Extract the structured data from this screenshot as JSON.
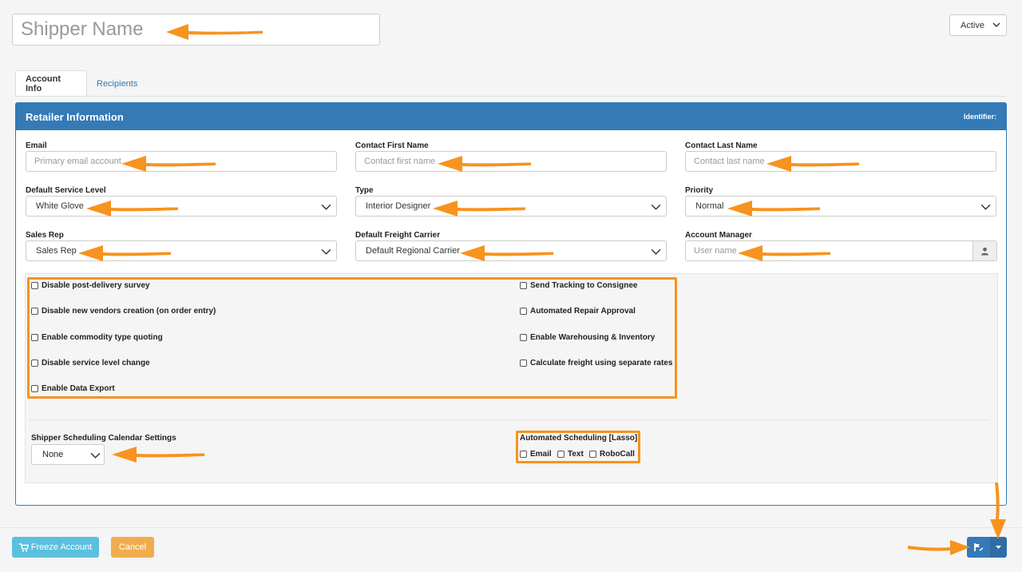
{
  "header": {
    "name_placeholder": "Shipper Name",
    "status_value": "Active"
  },
  "tabs": [
    {
      "label": "Account Info"
    },
    {
      "label": "Recipients"
    }
  ],
  "panel": {
    "title": "Retailer Information",
    "identifier_label": "Identifier:"
  },
  "fields": {
    "email": {
      "label": "Email",
      "placeholder": "Primary email account"
    },
    "contact_first": {
      "label": "Contact First Name",
      "placeholder": "Contact first name"
    },
    "contact_last": {
      "label": "Contact Last Name",
      "placeholder": "Contact last name"
    },
    "service_level": {
      "label": "Default Service Level",
      "value": "White Glove"
    },
    "type": {
      "label": "Type",
      "value": "Interior Designer"
    },
    "priority": {
      "label": "Priority",
      "value": "Normal"
    },
    "sales_rep": {
      "label": "Sales Rep",
      "value": "Sales Rep"
    },
    "freight_carrier": {
      "label": "Default Freight Carrier",
      "value": "Default Regional Carrier"
    },
    "account_manager": {
      "label": "Account Manager",
      "placeholder": "User name"
    }
  },
  "options_left": [
    "Disable post-delivery survey",
    "Disable new vendors creation (on order entry)",
    "Enable commodity type quoting",
    "Disable service level change",
    "Enable Data Export"
  ],
  "options_right": [
    "Send Tracking to Consignee",
    "Automated Repair Approval",
    "Enable Warehousing & Inventory",
    "Calculate freight using separate rates"
  ],
  "scheduling": {
    "calendar_label": "Shipper Scheduling Calendar Settings",
    "calendar_value": "None",
    "automated_label": "Automated Scheduling [Lasso]",
    "automated_options": [
      "Email",
      "Text",
      "RoboCall"
    ]
  },
  "footer": {
    "freeze_label": "Freeze Account",
    "cancel_label": "Cancel"
  },
  "colors": {
    "primary": "#337ab7",
    "info": "#5bc0de",
    "warning": "#f0ad4e",
    "annotation": "#f7931e"
  },
  "icons": {
    "freeze": "snowflake-cart-icon",
    "save": "save-icon",
    "caret": "caret-down-icon",
    "user": "user-icon"
  }
}
